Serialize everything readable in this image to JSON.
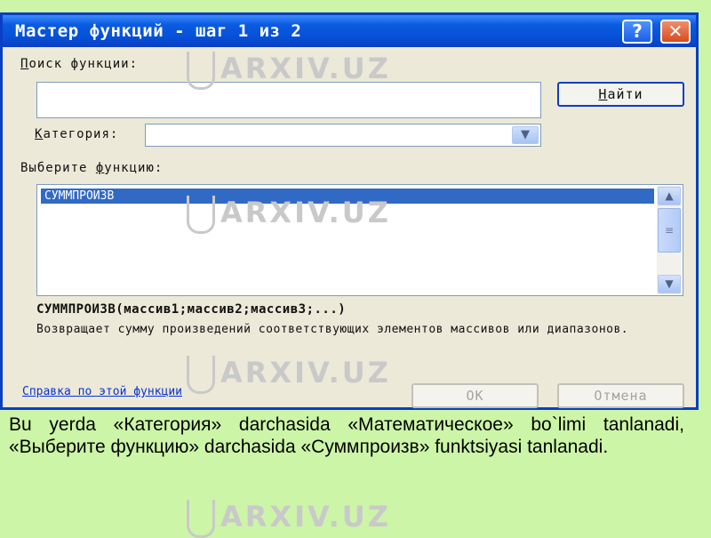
{
  "dialog": {
    "title": "Мастер функций - шаг 1 из 2",
    "help_button": "?",
    "close_button": "✕",
    "search_label_u": "П",
    "search_label_rest": "оиск функции:",
    "search_value": "",
    "find_button_u": "Н",
    "find_button_rest": "айти",
    "category_label_u": "К",
    "category_label_rest": "атегория:",
    "category_value": "",
    "select_fn_label_a": "Выберите ",
    "select_fn_label_u": "ф",
    "select_fn_label_b": "ункцию:",
    "functions": [
      "СУММПРОИЗВ"
    ],
    "signature": "СУММПРОИЗВ(массив1;массив2;массив3;...)",
    "description": "Возвращает сумму произведений соответствующих элементов массивов или диапазонов.",
    "help_link": "Справка по этой функции",
    "ok_button": "ОК",
    "cancel_button": "Отмена"
  },
  "watermark": "ARXIV.UZ",
  "caption": "Bu yerda «Категория» darchasida «Математическое» bo`limi tanlanadi, «Выберите функцию» darchasida «Суммпроизв» funktsiyasi tanlanadi."
}
